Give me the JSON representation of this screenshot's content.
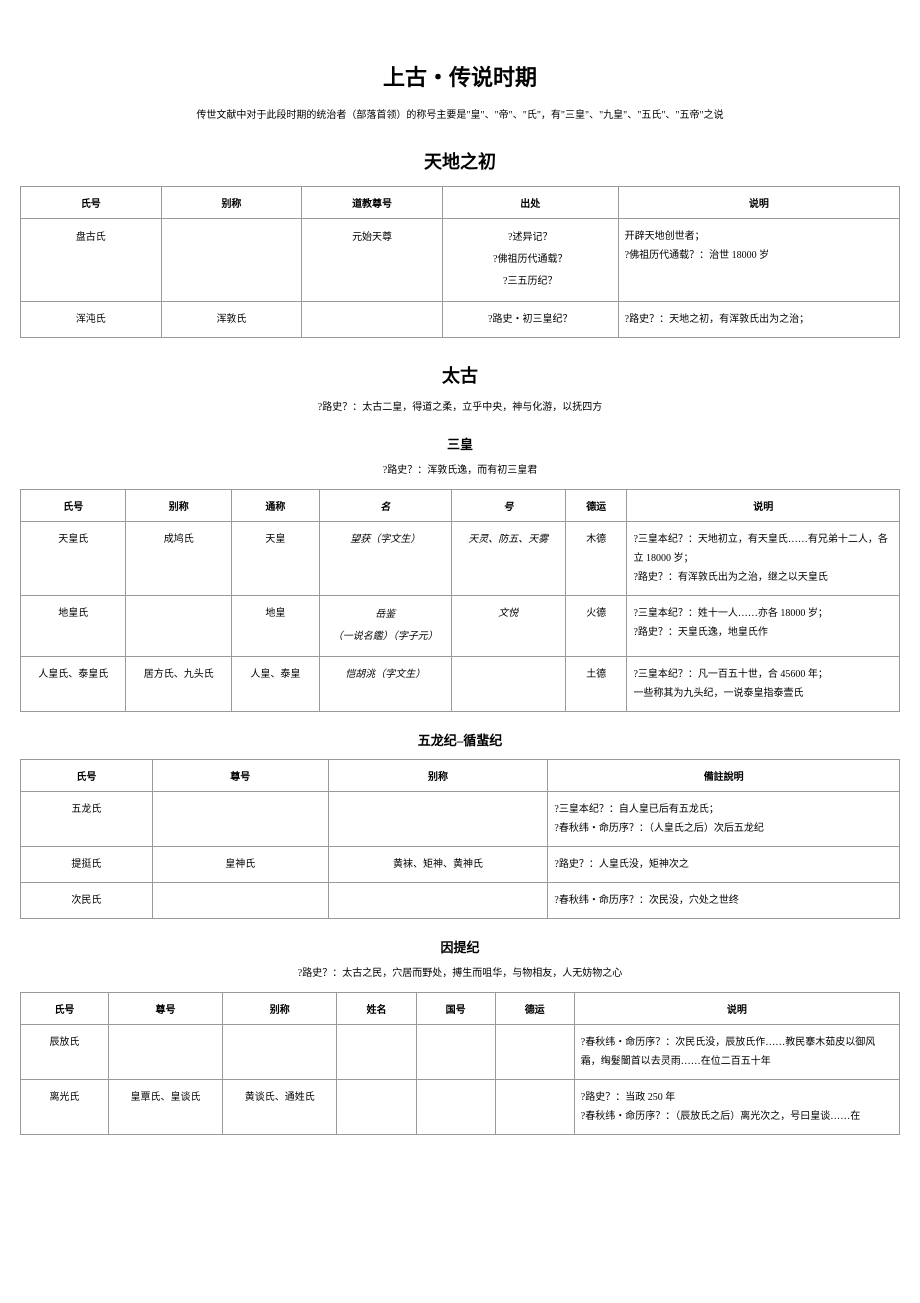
{
  "title": "上古・传说时期",
  "intro": "传世文献中对于此段时期的统治者（部落首领）的称号主要是\"皇\"、\"帝\"、\"氏\"，有\"三皇\"、\"九皇\"、\"五氏\"、\"五帝\"之说",
  "sec1": {
    "heading": "天地之初",
    "headers": [
      "氏号",
      "别称",
      "道教尊号",
      "出处",
      "说明"
    ],
    "rows": [
      {
        "c0": "盘古氏",
        "c1": "",
        "c2": "元始天尊",
        "c3": "?述异记？\n?佛祖历代通载？\n?三五历纪？",
        "c4": "开辟天地创世者；\n?佛祖历代通载？：治世 18000 岁"
      },
      {
        "c0": "浑沌氏",
        "c1": "浑敦氏",
        "c2": "",
        "c3": "?路史・初三皇纪？",
        "c4": "?路史？：天地之初，有浑敦氏出为之治；"
      }
    ]
  },
  "sec2": {
    "heading": "太古",
    "note": "?路史？：太古二皇，得道之柔，立乎中央，神与化游，以抚四方",
    "sub1": {
      "heading": "三皇",
      "note": "?路史？：浑敦氏逸，而有初三皇君",
      "headers": [
        "氏号",
        "别称",
        "通称",
        "名",
        "号",
        "德运",
        "说明"
      ],
      "rows": [
        {
          "c0": "天皇氏",
          "c1": "成鸠氏",
          "c2": "天皇",
          "c3": "望获（字文生）",
          "c4": "天灵、防五、天雾",
          "c5": "木德",
          "c6": "?三皇本纪？：天地初立，有天皇氏……有兄弟十二人，各立 18000 岁；\n?路史？：有浑敦氏出为之治，继之以天皇氏"
        },
        {
          "c0": "地皇氏",
          "c1": "",
          "c2": "地皇",
          "c3": "岳鉴\n（一说名鑑）（字子元）",
          "c4": "文悦",
          "c5": "火德",
          "c6": "?三皇本纪？：姓十一人……亦各 18000 岁；\n?路史？：天皇氏逸，地皇氏作"
        },
        {
          "c0": "人皇氏、泰皇氏",
          "c1": "居方氏、九头氏",
          "c2": "人皇、泰皇",
          "c3": "恺胡洮（字文生）",
          "c4": "",
          "c5": "土德",
          "c6": "?三皇本纪？：凡一百五十世，合 45600 年；\n一些称其为九头纪，一说泰皇指泰壹氏"
        }
      ]
    },
    "sub2": {
      "heading": "五龙纪–循蜚纪",
      "headers": [
        "氏号",
        "尊号",
        "别称",
        "備註說明"
      ],
      "rows": [
        {
          "c0": "五龙氏",
          "c1": "",
          "c2": "",
          "c3": "?三皇本纪？：自人皇已后有五龙氏；\n?春秋纬・命历序？：（人皇氏之后）次后五龙纪"
        },
        {
          "c0": "提挺氏",
          "c1": "皇神氏",
          "c2": "黄袜、矩神、黄神氏",
          "c3": "?路史？：人皇氏没，矩神次之"
        },
        {
          "c0": "次民氏",
          "c1": "",
          "c2": "",
          "c3": "?春秋纬・命历序？：次民没，穴处之世终"
        }
      ]
    },
    "sub3": {
      "heading": "因提纪",
      "note": "?路史？：太古之民，穴居而野处，搏生而咀华，与物相友，人无妨物之心",
      "headers": [
        "氏号",
        "尊号",
        "别称",
        "姓名",
        "国号",
        "德运",
        "说明"
      ],
      "rows": [
        {
          "c0": "辰放氏",
          "c1": "",
          "c2": "",
          "c3": "",
          "c4": "",
          "c5": "",
          "c6": "?春秋纬・命历序？：次民氏没，辰放氏作……教民搴木茹皮以御风霜，绹髮闓首以去灵雨……在位二百五十年"
        },
        {
          "c0": "离光氏",
          "c1": "皇覃氏、皇谈氏",
          "c2": "黄谈氏、通姓氏",
          "c3": "",
          "c4": "",
          "c5": "",
          "c6": "?路史？：当政 250 年\n?春秋纬・命历序？：（辰放氏之后）离光次之，号曰皇谈……在"
        }
      ]
    }
  }
}
